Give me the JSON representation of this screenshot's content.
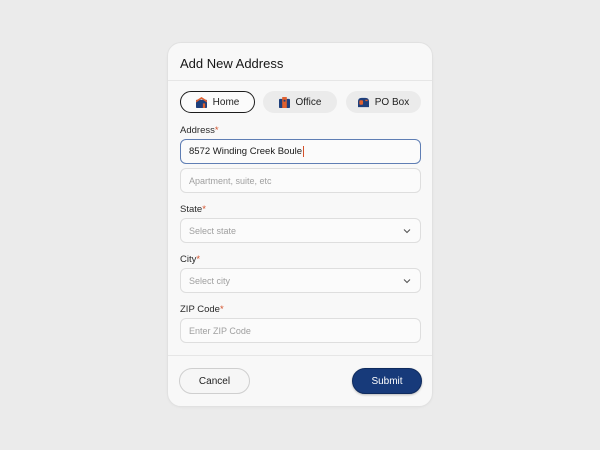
{
  "dialog": {
    "title": "Add New Address"
  },
  "address_types": [
    {
      "label": "Home",
      "icon": "house-icon",
      "selected": true
    },
    {
      "label": "Office",
      "icon": "building-icon",
      "selected": false
    },
    {
      "label": "PO Box",
      "icon": "mailbox-icon",
      "selected": false
    }
  ],
  "fields": {
    "address": {
      "label": "Address",
      "required_mark": "*",
      "value": "8572 Winding Creek Boule"
    },
    "address2": {
      "placeholder": "Apartment, suite, etc"
    },
    "state": {
      "label": "State",
      "required_mark": "*",
      "placeholder": "Select state"
    },
    "city": {
      "label": "City",
      "required_mark": "*",
      "placeholder": "Select city"
    },
    "zip": {
      "label": "ZIP Code",
      "required_mark": "*",
      "placeholder": "Enter ZIP Code"
    }
  },
  "actions": {
    "cancel_label": "Cancel",
    "submit_label": "Submit"
  },
  "colors": {
    "accent": "#173a7a",
    "required": "#d4512b",
    "focus_border": "#5f7eb4",
    "icon_orange": "#e0602f",
    "icon_navy": "#1e3f7c"
  }
}
